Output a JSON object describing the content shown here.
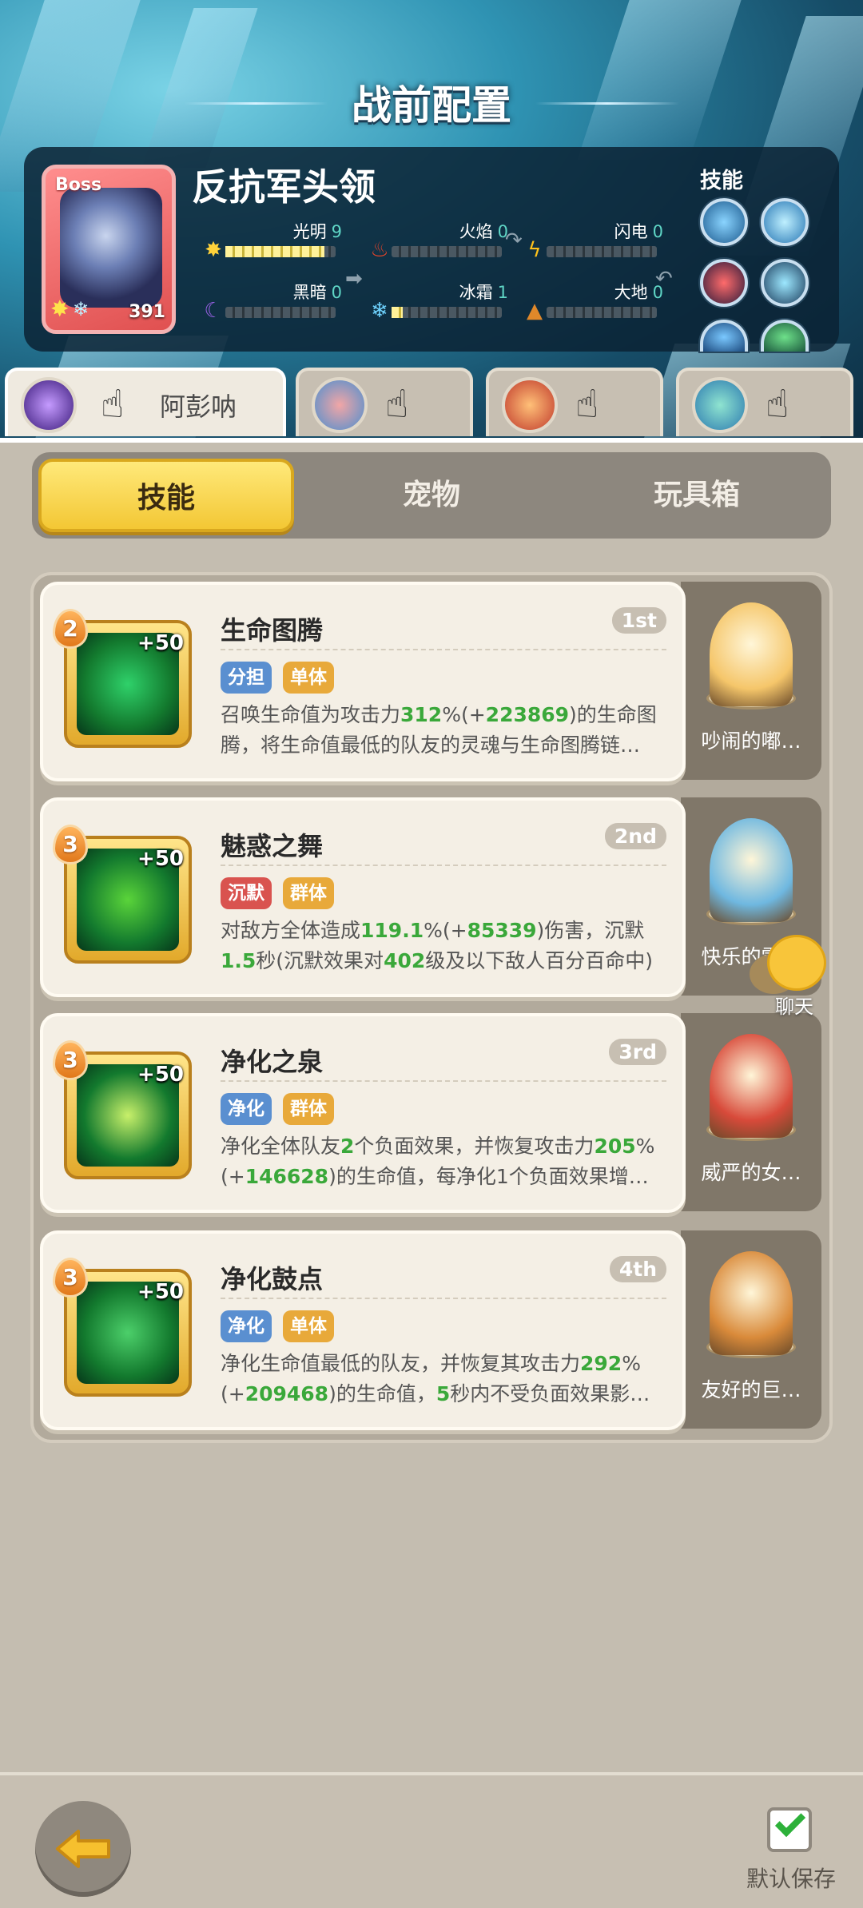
{
  "screen_title": "战前配置",
  "boss": {
    "tag": "Boss",
    "name": "反抗军头领",
    "level": "391",
    "elements": [
      {
        "label": "光明",
        "value": "9",
        "fill": 0.9,
        "icon": "sun-icon",
        "color": "#ffd23a"
      },
      {
        "label": "火焰",
        "value": "0",
        "fill": 0,
        "icon": "flame-icon",
        "color": "#e0432a"
      },
      {
        "label": "闪电",
        "value": "0",
        "fill": 0,
        "icon": "lightning-icon",
        "color": "#ffc21a"
      },
      {
        "label": "黑暗",
        "value": "0",
        "fill": 0,
        "icon": "moon-icon",
        "color": "#9b62e8"
      },
      {
        "label": "冰霜",
        "value": "1",
        "fill": 0.1,
        "icon": "snowflake-icon",
        "color": "#6fd3ff"
      },
      {
        "label": "大地",
        "value": "0",
        "fill": 0,
        "icon": "mountain-icon",
        "color": "#e0882a"
      }
    ],
    "skills_title": "技能"
  },
  "characters": [
    {
      "name": "阿彭呐",
      "selected": true
    },
    {
      "name": "",
      "selected": false
    },
    {
      "name": "",
      "selected": false
    },
    {
      "name": "",
      "selected": false
    }
  ],
  "tabs": [
    {
      "label": "技能",
      "active": true
    },
    {
      "label": "宠物",
      "active": false
    },
    {
      "label": "玩具箱",
      "active": false
    }
  ],
  "skills": [
    {
      "level": "2",
      "bonus": "+50",
      "name": "生命图腾",
      "order": "1st",
      "tags": [
        {
          "text": "分担",
          "color": "#5a8fd0"
        },
        {
          "text": "单体",
          "color": "#e8a93a"
        }
      ],
      "desc": [
        {
          "t": "召唤生命值为攻击力"
        },
        {
          "t": "312",
          "g": true
        },
        {
          "t": "%(+"
        },
        {
          "t": "223869",
          "g": true
        },
        {
          "t": ")的生命图腾，将生命值最低的队友的灵魂与生命图腾链…"
        }
      ],
      "pet": "吵闹的嘟…",
      "pet_color": "#f5c66a"
    },
    {
      "level": "3",
      "bonus": "+50",
      "name": "魅惑之舞",
      "order": "2nd",
      "tags": [
        {
          "text": "沉默",
          "color": "#d9534f"
        },
        {
          "text": "群体",
          "color": "#e8a93a"
        }
      ],
      "desc": [
        {
          "t": "对敌方全体造成"
        },
        {
          "t": "119.1",
          "g": true
        },
        {
          "t": "%(+"
        },
        {
          "t": "85339",
          "g": true
        },
        {
          "t": ")伤害，沉默"
        },
        {
          "t": "1.5",
          "g": true
        },
        {
          "t": "秒(沉默效果对"
        },
        {
          "t": "402",
          "g": true
        },
        {
          "t": "级及以下敌人百分百命中)"
        }
      ],
      "pet": "快乐的雪…",
      "pet_color": "#6fb8e0"
    },
    {
      "level": "3",
      "bonus": "+50",
      "name": "净化之泉",
      "order": "3rd",
      "tags": [
        {
          "text": "净化",
          "color": "#5a8fd0"
        },
        {
          "text": "群体",
          "color": "#e8a93a"
        }
      ],
      "desc": [
        {
          "t": "净化全体队友"
        },
        {
          "t": "2",
          "g": true
        },
        {
          "t": "个负面效果，并恢复攻击力"
        },
        {
          "t": "205",
          "g": true
        },
        {
          "t": "%(+"
        },
        {
          "t": "146628",
          "g": true
        },
        {
          "t": ")的生命值，每净化1个负面效果增…"
        }
      ],
      "pet": "威严的女…",
      "pet_color": "#d84a3a"
    },
    {
      "level": "3",
      "bonus": "+50",
      "name": "净化鼓点",
      "order": "4th",
      "tags": [
        {
          "text": "净化",
          "color": "#5a8fd0"
        },
        {
          "text": "单体",
          "color": "#e8a93a"
        }
      ],
      "desc": [
        {
          "t": "净化生命值最低的队友，并恢复其攻击力"
        },
        {
          "t": "292",
          "g": true
        },
        {
          "t": "%(+"
        },
        {
          "t": "209468",
          "g": true
        },
        {
          "t": ")的生命值，"
        },
        {
          "t": "5",
          "g": true
        },
        {
          "t": "秒内不受负面效果影…"
        }
      ],
      "pet": "友好的巨…",
      "pet_color": "#d98a3a"
    }
  ],
  "chat_label": "聊天",
  "save_label": "默认保存",
  "save_checked": true
}
